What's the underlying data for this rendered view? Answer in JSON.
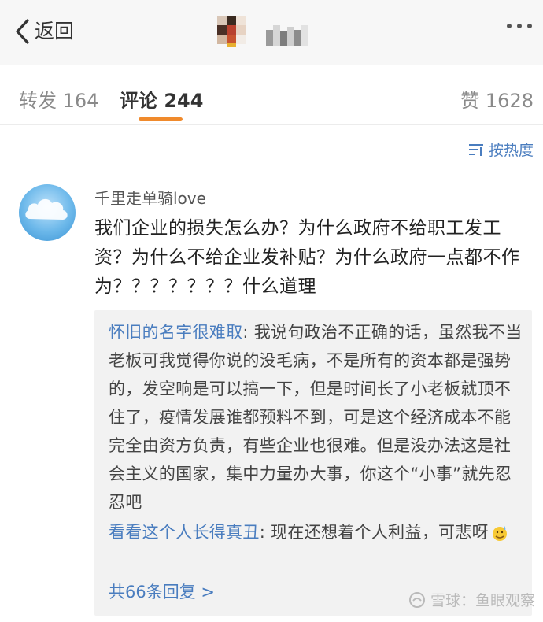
{
  "header": {
    "back_label": "返回"
  },
  "tabs": [
    {
      "label": "转发 164"
    },
    {
      "label": "评论 244"
    },
    {
      "label": "赞 1628"
    }
  ],
  "sort_label": "按热度",
  "comment": {
    "username": "千里走单骑love",
    "text": "我们企业的损失怎么办？为什么政府不给职工发工资？为什么不给企业发补贴？为什么政府一点都不作为？？？？？？？什么道理"
  },
  "replies": [
    {
      "author": "怀旧的名字很难取",
      "text": ": 我说句政治不正确的话，虽然我不当老板可我觉得你说的没毛病，不是所有的资本都是强势的，发空响是可以搞一下，但是时间长了小老板就顶不住了，疫情发展谁都预料不到，可是这个经济成本不能完全由资方负责，有些企业也很难。但是没办法这是社会主义的国家，集中力量办大事，你这个“小事”就先忍忍吧"
    },
    {
      "author": "看看这个人长得真丑",
      "text": ": 现在还想着个人利益，可悲呀"
    }
  ],
  "more_replies_label": "共66条回复 >",
  "watermark": "雪球：鱼眼观察"
}
